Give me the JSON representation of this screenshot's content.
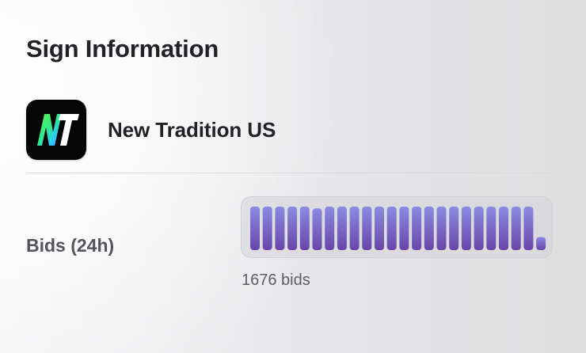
{
  "section": {
    "title": "Sign Information"
  },
  "app": {
    "name": "New Tradition US",
    "logo_text": "NT",
    "logo_icon": "new-tradition-logo-icon"
  },
  "bids": {
    "label": "Bids (24h)",
    "count_text": "1676 bids"
  },
  "chart_data": {
    "type": "bar",
    "series": [
      {
        "values": [
          1,
          1,
          1,
          1,
          1,
          0.96,
          1,
          1,
          1,
          1,
          1,
          1,
          1,
          1,
          1,
          1,
          1,
          1,
          1,
          1,
          1,
          1,
          1,
          0.3
        ]
      }
    ],
    "ylim": [
      0,
      1
    ],
    "colors": {
      "bar_top": "#8c8ae2",
      "bar_bottom": "#6a45aa"
    }
  }
}
